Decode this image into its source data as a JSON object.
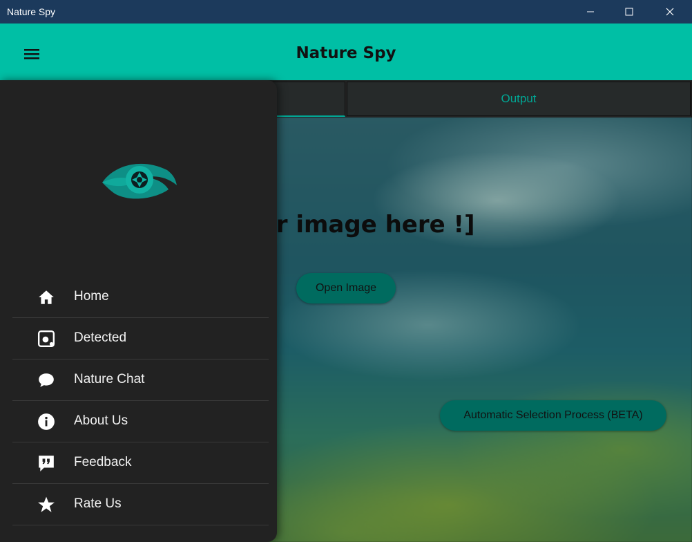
{
  "window": {
    "title": "Nature Spy"
  },
  "appbar": {
    "title": "Nature Spy"
  },
  "tabs": [
    {
      "label": ""
    },
    {
      "label": "Output"
    }
  ],
  "main": {
    "drop_text": "your image here !]",
    "open_button": "Open Image",
    "auto_button": "Automatic Selection Process (BETA)"
  },
  "drawer": {
    "items": [
      {
        "label": "Home",
        "icon": "home-icon"
      },
      {
        "label": "Detected",
        "icon": "detected-icon"
      },
      {
        "label": "Nature Chat",
        "icon": "chat-icon"
      },
      {
        "label": "About Us",
        "icon": "info-icon"
      },
      {
        "label": "Feedback",
        "icon": "feedback-icon"
      },
      {
        "label": "Rate Us",
        "icon": "star-icon"
      }
    ]
  },
  "colors": {
    "accent": "#00bfa5",
    "drawer": "#222222",
    "titlebar": "#1c3a5c",
    "button": "#006b5f"
  }
}
